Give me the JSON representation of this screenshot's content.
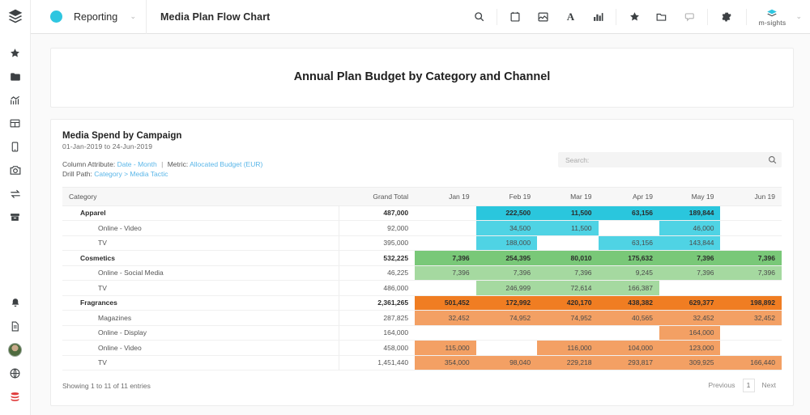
{
  "rail": {
    "logo_icon": "layers-logo-icon",
    "items": [
      {
        "icon": "star-icon",
        "name": "favorites"
      },
      {
        "icon": "folder-icon",
        "name": "folders"
      },
      {
        "icon": "analytics-icon",
        "name": "analytics"
      },
      {
        "icon": "table-icon",
        "name": "tables"
      },
      {
        "icon": "mobile-icon",
        "name": "mobile"
      },
      {
        "icon": "camera-icon",
        "name": "snapshots"
      },
      {
        "icon": "transfer-icon",
        "name": "transfers"
      },
      {
        "icon": "archive-icon",
        "name": "archive"
      }
    ],
    "bottom_items": [
      {
        "icon": "bell-icon",
        "name": "notifications"
      },
      {
        "icon": "document-icon",
        "name": "documents"
      },
      {
        "icon": "avatar",
        "name": "user-avatar"
      },
      {
        "icon": "globe-icon",
        "name": "globe"
      },
      {
        "icon": "database-icon",
        "name": "database"
      }
    ]
  },
  "topbar": {
    "module_label": "Reporting",
    "module_caret": "⌄",
    "title": "Media Plan Flow Chart",
    "icons": [
      {
        "icon": "search-icon",
        "name": "search-button"
      },
      {
        "icon": "calendar-icon",
        "name": "calendar-button"
      },
      {
        "icon": "image-icon",
        "name": "image-button"
      },
      {
        "icon": "text-icon",
        "name": "text-button",
        "glyph": "A"
      },
      {
        "icon": "chart-icon",
        "name": "chart-button"
      },
      {
        "icon": "star-icon",
        "name": "favorite-button"
      },
      {
        "icon": "folder-open-icon",
        "name": "open-folder-button"
      },
      {
        "icon": "comment-icon",
        "name": "comments-button"
      },
      {
        "icon": "gear-icon",
        "name": "settings-button"
      }
    ],
    "user_name": "m-sights",
    "user_caret": "⌄"
  },
  "page": {
    "title": "Annual Plan Budget by Category and Channel"
  },
  "report": {
    "title": "Media Spend by Campaign",
    "date_range": "01-Jan-2019 to 24-Jun-2019",
    "column_attribute_label": "Column Attribute:",
    "column_attribute_value": "Date - Month",
    "metric_label": "Metric:",
    "metric_value": "Allocated Budget (EUR)",
    "drill_path_label": "Drill Path:",
    "drill_path_value": "Category > Media Tactic",
    "search_placeholder": "Search:",
    "search_value": "",
    "footer_text": "Showing 1 to 11 of 11 entries",
    "pager": {
      "previous": "Previous",
      "current": "1",
      "next": "Next"
    }
  },
  "chart_data": {
    "type": "table",
    "title": "Media Spend by Campaign",
    "columns": [
      "Category",
      "Grand Total",
      "Jan 19",
      "Feb 19",
      "Mar 19",
      "Apr 19",
      "May 19",
      "Jun 19"
    ],
    "colors": {
      "apparel_strong": "#2ac6dd",
      "apparel_light": "#4fd3e4",
      "cosmetics_strong": "#79c878",
      "cosmetics_light": "#a5d9a0",
      "fragrances_strong": "#f07d22",
      "fragrances_light": "#f3a064"
    },
    "rows": [
      {
        "level": 0,
        "label": "Apparel",
        "grand_total": "487,000",
        "values": [
          "",
          "222,500",
          "11,500",
          "63,156",
          "189,844",
          ""
        ],
        "fills": [
          "",
          "s",
          "s",
          "s",
          "s",
          ""
        ]
      },
      {
        "level": 1,
        "label": "Online - Video",
        "grand_total": "92,000",
        "values": [
          "",
          "34,500",
          "11,500",
          "",
          "46,000",
          ""
        ],
        "fills": [
          "",
          "l",
          "l",
          "",
          "l",
          ""
        ]
      },
      {
        "level": 1,
        "label": "TV",
        "grand_total": "395,000",
        "values": [
          "",
          "188,000",
          "",
          "63,156",
          "143,844",
          ""
        ],
        "fills": [
          "",
          "l",
          "",
          "l",
          "l",
          ""
        ]
      },
      {
        "level": 0,
        "label": "Cosmetics",
        "grand_total": "532,225",
        "values": [
          "7,396",
          "254,395",
          "80,010",
          "175,632",
          "7,396",
          "7,396"
        ],
        "fills": [
          "s",
          "s",
          "s",
          "s",
          "s",
          "s"
        ]
      },
      {
        "level": 1,
        "label": "Online - Social Media",
        "grand_total": "46,225",
        "values": [
          "7,396",
          "7,396",
          "7,396",
          "9,245",
          "7,396",
          "7,396"
        ],
        "fills": [
          "l",
          "l",
          "l",
          "l",
          "l",
          "l"
        ]
      },
      {
        "level": 1,
        "label": "TV",
        "grand_total": "486,000",
        "values": [
          "",
          "246,999",
          "72,614",
          "166,387",
          "",
          ""
        ],
        "fills": [
          "",
          "l",
          "l",
          "l",
          "",
          ""
        ]
      },
      {
        "level": 0,
        "label": "Fragrances",
        "grand_total": "2,361,265",
        "values": [
          "501,452",
          "172,992",
          "420,170",
          "438,382",
          "629,377",
          "198,892"
        ],
        "fills": [
          "s",
          "s",
          "s",
          "s",
          "s",
          "s"
        ]
      },
      {
        "level": 1,
        "label": "Magazines",
        "grand_total": "287,825",
        "values": [
          "32,452",
          "74,952",
          "74,952",
          "40,565",
          "32,452",
          "32,452"
        ],
        "fills": [
          "l",
          "l",
          "l",
          "l",
          "l",
          "l"
        ]
      },
      {
        "level": 1,
        "label": "Online - Display",
        "grand_total": "164,000",
        "values": [
          "",
          "",
          "",
          "",
          "164,000",
          ""
        ],
        "fills": [
          "",
          "",
          "",
          "",
          "l",
          ""
        ]
      },
      {
        "level": 1,
        "label": "Online - Video",
        "grand_total": "458,000",
        "values": [
          "115,000",
          "",
          "116,000",
          "104,000",
          "123,000",
          ""
        ],
        "fills": [
          "l",
          "",
          "l",
          "l",
          "l",
          ""
        ]
      },
      {
        "level": 1,
        "label": "TV",
        "grand_total": "1,451,440",
        "values": [
          "354,000",
          "98,040",
          "229,218",
          "293,817",
          "309,925",
          "166,440"
        ],
        "fills": [
          "l",
          "l",
          "l",
          "l",
          "l",
          "l"
        ]
      }
    ],
    "row_group": [
      0,
      0,
      0,
      1,
      1,
      1,
      2,
      2,
      2,
      2,
      2
    ]
  }
}
